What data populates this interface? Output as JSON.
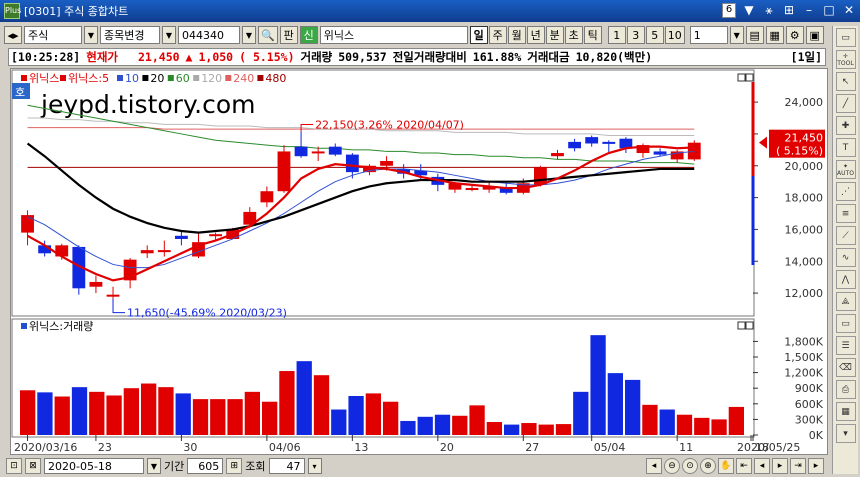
{
  "window": {
    "logo": "Plus",
    "title": "[0301] 주식 종합차트",
    "page_num": "6"
  },
  "toolbar": {
    "market": "주식",
    "change_btn": "종목변경",
    "code": "044340",
    "pan_btn": "판",
    "credit_badge": "신",
    "stock_name": "위닉스",
    "periods": [
      "일",
      "주",
      "월",
      "년",
      "분",
      "초",
      "틱"
    ],
    "active_period": "일",
    "intervals": [
      "1",
      "3",
      "5",
      "10"
    ],
    "interval_value": "1"
  },
  "quote": {
    "time": "[10:25:28]",
    "price_label": "현재가",
    "price": "21,450",
    "arrow": "▲",
    "change": "1,050",
    "change_pct": "( 5.15%)",
    "volume_label": "거래량",
    "volume": "509,537",
    "prev_vol_label": "전일거래량대비",
    "prev_vol_pct": "161.88%",
    "amount_label": "거래대금",
    "amount": "10,820(백만)",
    "period_label": "[1일]"
  },
  "chart": {
    "watermark": "jeypd.tistory.com",
    "badge": "호",
    "legend": [
      {
        "text": "위닉스",
        "color": "#e00000"
      },
      {
        "text": "위닉스:5",
        "color": "#e00000"
      },
      {
        "text": "10",
        "color": "#3050d0"
      },
      {
        "text": "20",
        "color": "#000000"
      },
      {
        "text": "60",
        "color": "#2a8a2a"
      },
      {
        "text": "120",
        "color": "#aaaaaa"
      },
      {
        "text": "240",
        "color": "#e06060"
      },
      {
        "text": "480",
        "color": "#a00000"
      }
    ],
    "volume_legend": "위닉스:거래량",
    "high_annotation": "22,150(3.26% 2020/04/07)",
    "low_annotation": "11,650(-45.69% 2020/03/23)",
    "price_tag": [
      "21,450",
      "( 5.15%)"
    ],
    "x_labels": [
      "2020/03/16",
      "23",
      "30",
      "04/06",
      "13",
      "20",
      "27",
      "05/04",
      "11",
      "18",
      "2020/05/25"
    ]
  },
  "chart_data": {
    "type": "candlestick",
    "price_axis": {
      "ticks": [
        "12,000",
        "14,000",
        "16,000",
        "18,000",
        "20,000",
        "22,000",
        "24,000"
      ],
      "ylim": [
        11000,
        25200
      ]
    },
    "volume_axis": {
      "ticks": [
        "0K",
        "300K",
        "600K",
        "900K",
        "1,200K",
        "1,500K",
        "1,800K"
      ],
      "ylim": [
        0,
        2000
      ]
    },
    "candles": [
      {
        "o": 15800,
        "h": 17200,
        "l": 15000,
        "c": 16900
      },
      {
        "o": 15000,
        "h": 15300,
        "l": 14300,
        "c": 14500
      },
      {
        "o": 14300,
        "h": 15100,
        "l": 14100,
        "c": 15000
      },
      {
        "o": 14900,
        "h": 15000,
        "l": 11900,
        "c": 12300
      },
      {
        "o": 12400,
        "h": 13100,
        "l": 12000,
        "c": 12700
      },
      {
        "o": 11900,
        "h": 12400,
        "l": 11650,
        "c": 11900
      },
      {
        "o": 12800,
        "h": 14200,
        "l": 12300,
        "c": 14100
      },
      {
        "o": 14500,
        "h": 15000,
        "l": 14200,
        "c": 14700
      },
      {
        "o": 14700,
        "h": 15300,
        "l": 14300,
        "c": 14700
      },
      {
        "o": 15600,
        "h": 15900,
        "l": 15000,
        "c": 15400
      },
      {
        "o": 14300,
        "h": 15800,
        "l": 14200,
        "c": 15200
      },
      {
        "o": 15700,
        "h": 15800,
        "l": 15300,
        "c": 15700
      },
      {
        "o": 15400,
        "h": 16100,
        "l": 15400,
        "c": 16000
      },
      {
        "o": 16300,
        "h": 17400,
        "l": 16100,
        "c": 17100
      },
      {
        "o": 17700,
        "h": 18700,
        "l": 17400,
        "c": 18400
      },
      {
        "o": 18400,
        "h": 21300,
        "l": 18300,
        "c": 20900
      },
      {
        "o": 21200,
        "h": 22150,
        "l": 20500,
        "c": 20600
      },
      {
        "o": 20900,
        "h": 21200,
        "l": 20300,
        "c": 20900
      },
      {
        "o": 21200,
        "h": 21400,
        "l": 20600,
        "c": 20700
      },
      {
        "o": 20700,
        "h": 20800,
        "l": 19200,
        "c": 19600
      },
      {
        "o": 19600,
        "h": 20100,
        "l": 19400,
        "c": 20000
      },
      {
        "o": 20000,
        "h": 20600,
        "l": 19700,
        "c": 20300
      },
      {
        "o": 19800,
        "h": 20100,
        "l": 19200,
        "c": 19500
      },
      {
        "o": 19700,
        "h": 20100,
        "l": 19100,
        "c": 19400
      },
      {
        "o": 19300,
        "h": 19500,
        "l": 18400,
        "c": 18800
      },
      {
        "o": 18500,
        "h": 19000,
        "l": 18300,
        "c": 18900
      },
      {
        "o": 18600,
        "h": 18800,
        "l": 18400,
        "c": 18600
      },
      {
        "o": 18500,
        "h": 19000,
        "l": 18300,
        "c": 18700
      },
      {
        "o": 18600,
        "h": 19000,
        "l": 18200,
        "c": 18300
      },
      {
        "o": 18300,
        "h": 19200,
        "l": 18200,
        "c": 18900
      },
      {
        "o": 18800,
        "h": 20000,
        "l": 18700,
        "c": 19900
      },
      {
        "o": 20600,
        "h": 21000,
        "l": 20400,
        "c": 20800
      },
      {
        "o": 21500,
        "h": 21700,
        "l": 20900,
        "c": 21100
      },
      {
        "o": 21800,
        "h": 21900,
        "l": 21200,
        "c": 21400
      },
      {
        "o": 21500,
        "h": 21600,
        "l": 20800,
        "c": 21400
      },
      {
        "o": 21700,
        "h": 21800,
        "l": 20800,
        "c": 21100
      },
      {
        "o": 20800,
        "h": 21400,
        "l": 20500,
        "c": 21300
      },
      {
        "o": 20900,
        "h": 21100,
        "l": 20600,
        "c": 20700
      },
      {
        "o": 20400,
        "h": 21000,
        "l": 20200,
        "c": 20900
      },
      {
        "o": 20400,
        "h": 21600,
        "l": 20300,
        "c": 21450
      }
    ],
    "volumes": [
      860,
      820,
      740,
      920,
      830,
      760,
      900,
      990,
      920,
      800,
      690,
      690,
      690,
      830,
      640,
      1230,
      1420,
      1150,
      490,
      750,
      800,
      640,
      270,
      350,
      390,
      370,
      570,
      250,
      200,
      230,
      200,
      210,
      830,
      1920,
      1190,
      1060,
      580,
      490,
      390,
      330,
      300,
      540
    ],
    "ma5": [
      15600,
      15000,
      14300,
      13700,
      13200,
      12800,
      13000,
      13500,
      14000,
      14500,
      15000,
      15300,
      15700,
      16200,
      17000,
      18000,
      19200,
      19800,
      20100,
      20000,
      19900,
      19800,
      19600,
      19300,
      19100,
      18900,
      18800,
      18700,
      18600,
      18600,
      18800,
      19200,
      19700,
      20300,
      20800,
      21100,
      21200,
      21200,
      21100,
      21150
    ],
    "ma10": [
      16800,
      16300,
      15600,
      14900,
      14300,
      13800,
      13600,
      13600,
      13800,
      14200,
      14600,
      15000,
      15400,
      15900,
      16400,
      17000,
      17700,
      18400,
      19000,
      19400,
      19700,
      19800,
      19800,
      19700,
      19600,
      19400,
      19200,
      19000,
      18900,
      18800,
      18800,
      18900,
      19100,
      19400,
      19800,
      20100,
      20400,
      20600,
      20800,
      20900
    ],
    "ma20": [
      21400,
      20600,
      19700,
      18800,
      18000,
      17300,
      16800,
      16400,
      16100,
      15900,
      15800,
      15900,
      16000,
      16200,
      16500,
      16800,
      17200,
      17600,
      18000,
      18400,
      18700,
      18900,
      19000,
      19100,
      19100,
      19100,
      19000,
      19000,
      19000,
      19000,
      19100,
      19200,
      19300,
      19400,
      19500,
      19600,
      19700,
      19800,
      19800,
      19800
    ],
    "ma60": [
      23800,
      23600,
      23400,
      23200,
      23000,
      22800,
      22600,
      22400,
      22200,
      22000,
      21800,
      21600,
      21500,
      21400,
      21300,
      21200,
      21200,
      21100,
      21100,
      21000,
      21000,
      20900,
      20900,
      20800,
      20800,
      20700,
      20700,
      20600,
      20600,
      20500,
      20500,
      20400,
      20400,
      20300,
      20300,
      20300,
      20200,
      20200,
      20200,
      20100
    ],
    "ma120": [
      23000,
      23000,
      22900,
      22900,
      22800,
      22800,
      22700,
      22700,
      22600,
      22600,
      22600,
      22500,
      22500,
      22500,
      22400,
      22400,
      22400,
      22300,
      22300,
      22300,
      22300,
      22200,
      22200,
      22200,
      22200,
      22100,
      22100,
      22100,
      22100,
      22000,
      22000,
      22000,
      22000,
      22000,
      21900,
      21900,
      21900,
      21900,
      21900,
      21900
    ],
    "ma240": [
      22400,
      22400,
      22400,
      22400,
      22400,
      22400,
      22400,
      22400,
      22300,
      22300,
      22300,
      22300,
      22300,
      22300,
      22300,
      22300,
      22300,
      22300,
      22300,
      22300,
      22300,
      22300,
      22300,
      22300,
      22300,
      22300,
      22300,
      22300,
      22300,
      22300,
      22300,
      22300,
      22300,
      22300,
      22300,
      22300,
      22300,
      22300,
      22300,
      22300
    ],
    "ma480": [
      19900,
      19900,
      19900,
      19900,
      19900,
      19900,
      19900,
      19900,
      19900,
      19900,
      19900,
      19900,
      19900,
      19900,
      19900,
      19900,
      19900,
      19900,
      19900,
      19900,
      19900,
      19900,
      19900,
      19900,
      19900,
      19900,
      19900,
      19900,
      19900,
      19900,
      19900,
      19900,
      19900,
      19900,
      19900,
      19900,
      19900,
      19900,
      19900,
      19900
    ]
  },
  "bottom": {
    "date": "2020-05-18",
    "period_label": "기간",
    "period_value": "605",
    "query_label": "조회",
    "query_value": "47"
  }
}
